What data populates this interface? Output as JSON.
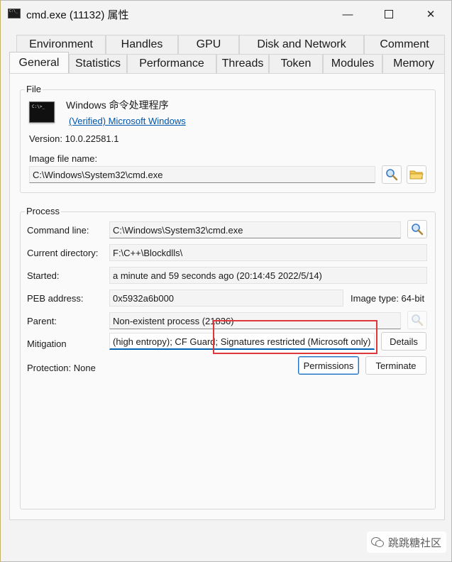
{
  "window": {
    "title": "cmd.exe (11132) 属性",
    "minimize": "—",
    "close": "✕"
  },
  "tabs": {
    "row1": [
      "Environment",
      "Handles",
      "GPU",
      "Disk and Network",
      "Comment"
    ],
    "row2": [
      "General",
      "Statistics",
      "Performance",
      "Threads",
      "Token",
      "Modules",
      "Memory"
    ],
    "active": "General"
  },
  "file": {
    "group_label": "File",
    "description": "Windows 命令处理程序",
    "verified_link": "(Verified) Microsoft Windows",
    "version": "Version: 10.0.22581.1",
    "image_file_label": "Image file name:",
    "image_file_value": "C:\\Windows\\System32\\cmd.exe"
  },
  "process": {
    "group_label": "Process",
    "command_line_label": "Command line:",
    "command_line_value": "C:\\Windows\\System32\\cmd.exe",
    "current_dir_label": "Current directory:",
    "current_dir_value": "F:\\C++\\Blockdlls\\",
    "started_label": "Started:",
    "started_value": "a minute and 59 seconds ago (20:14:45 2022/5/14)",
    "peb_label": "PEB address:",
    "peb_value": "0x5932a6b000",
    "image_type": "Image type:  64-bit",
    "parent_label": "Parent:",
    "parent_value": "Non-existent process (21836)",
    "mitigation_label": "Mitigation",
    "mitigation_value": " (high entropy); CF Guard; Signatures restricted (Microsoft only)",
    "details_button": "Details",
    "protection": "Protection:  None",
    "permissions_button": "Permissions",
    "terminate_button": "Terminate"
  },
  "watermark": {
    "text": "跳跳糖社区"
  },
  "colors": {
    "accent": "#0063b1",
    "highlight_box": "#e0383a",
    "link": "#0055aa"
  }
}
